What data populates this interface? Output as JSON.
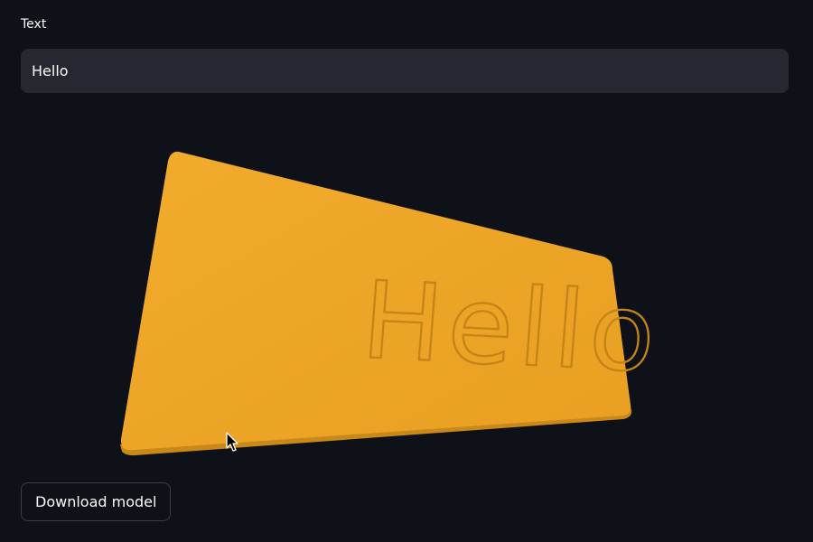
{
  "input": {
    "label": "Text",
    "value": "Hello"
  },
  "model": {
    "engraved_text": "Hello",
    "plate_color": "#f0a82a",
    "engrave_color": "#d79220"
  },
  "actions": {
    "download_label": "Download model"
  },
  "colors": {
    "background": "#0e1117",
    "input_bg": "#262730",
    "text": "#fafafa"
  }
}
